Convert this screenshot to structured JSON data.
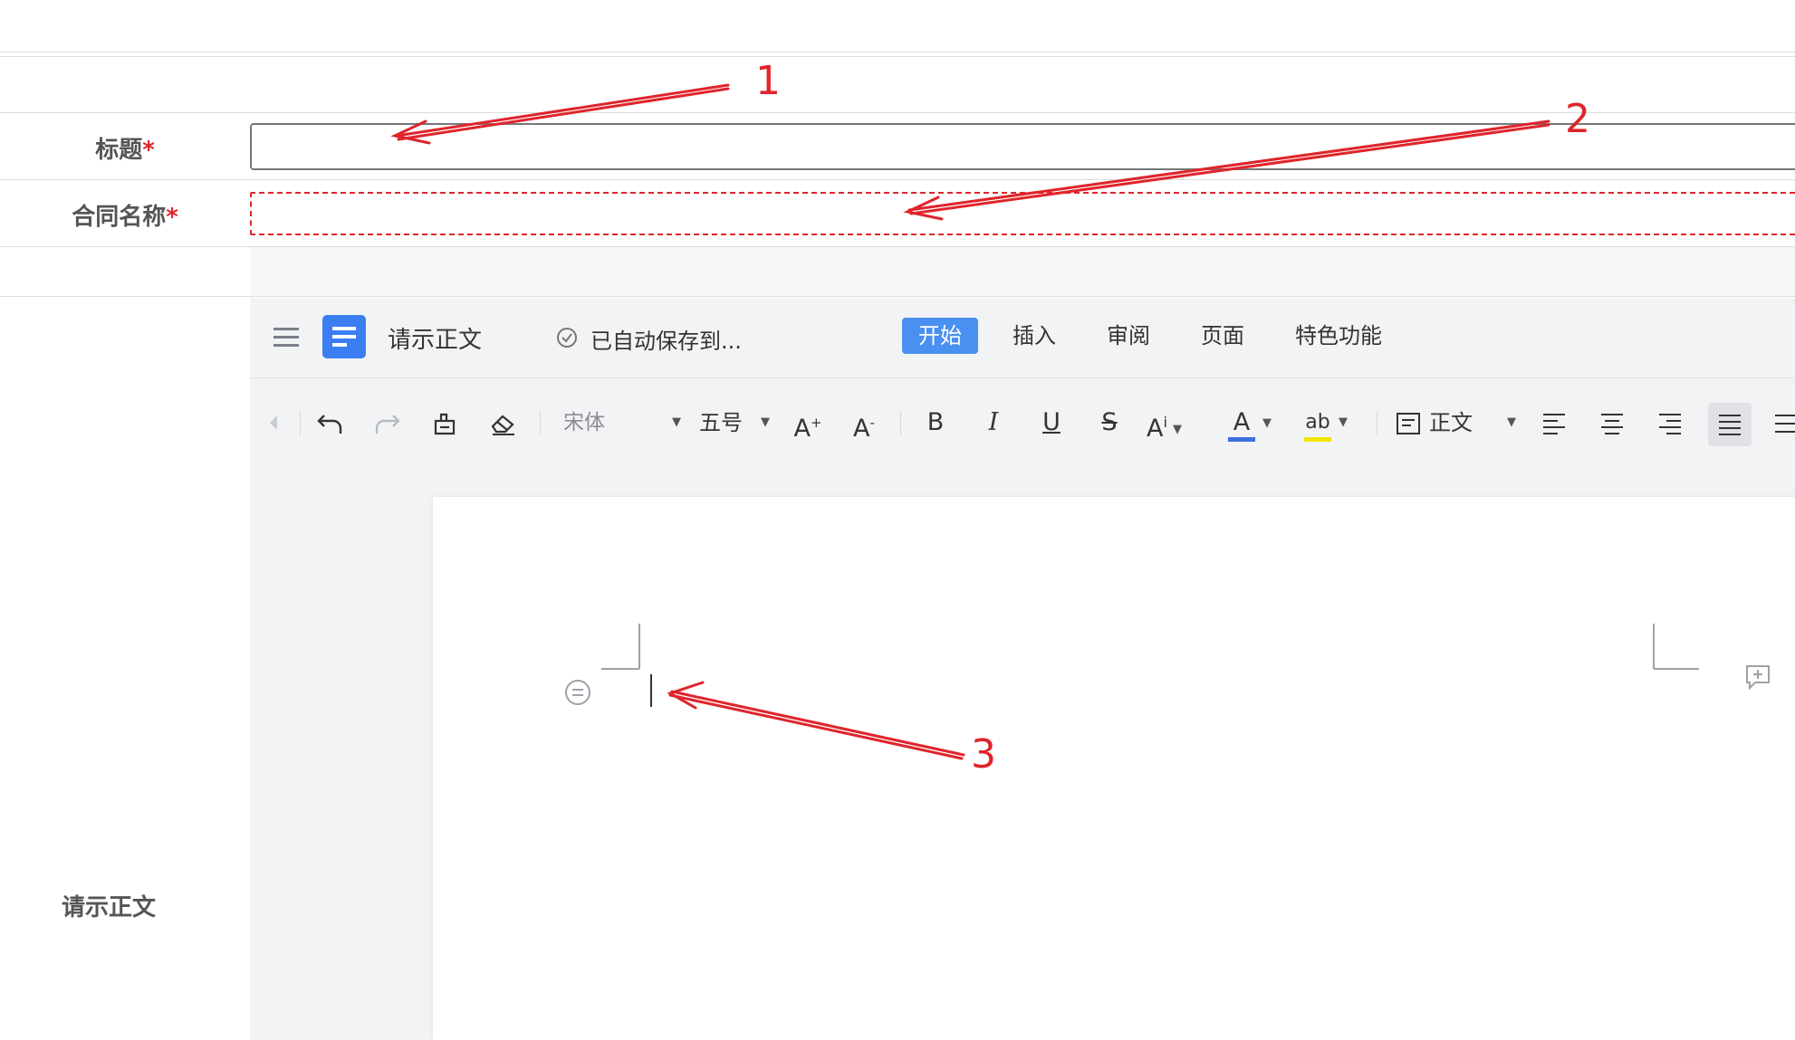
{
  "form": {
    "title_label": "标题",
    "title_required": "*",
    "title_value": "",
    "contract_label": "合同名称",
    "contract_required": "*",
    "contract_value": "",
    "body_label": "请示正文"
  },
  "editor": {
    "doc_title": "请示正文",
    "autosave_text": "已自动保存到...",
    "tabs": [
      {
        "label": "开始",
        "active": true
      },
      {
        "label": "插入",
        "active": false
      },
      {
        "label": "审阅",
        "active": false
      },
      {
        "label": "页面",
        "active": false
      },
      {
        "label": "特色功能",
        "active": false
      }
    ],
    "toolbar": {
      "font_name": "宋体",
      "font_size": "五号",
      "style_label": "正文",
      "bold": "B",
      "italic": "I",
      "underline": "U",
      "strike": "S",
      "font_color_letter": "A",
      "highlight_letter": "ab"
    },
    "font_color": "#3b6fe0",
    "highlight_color": "#f2e600"
  },
  "annotations": {
    "label_1": "1",
    "label_2": "2",
    "label_3": "3",
    "color": "#e0242b"
  }
}
